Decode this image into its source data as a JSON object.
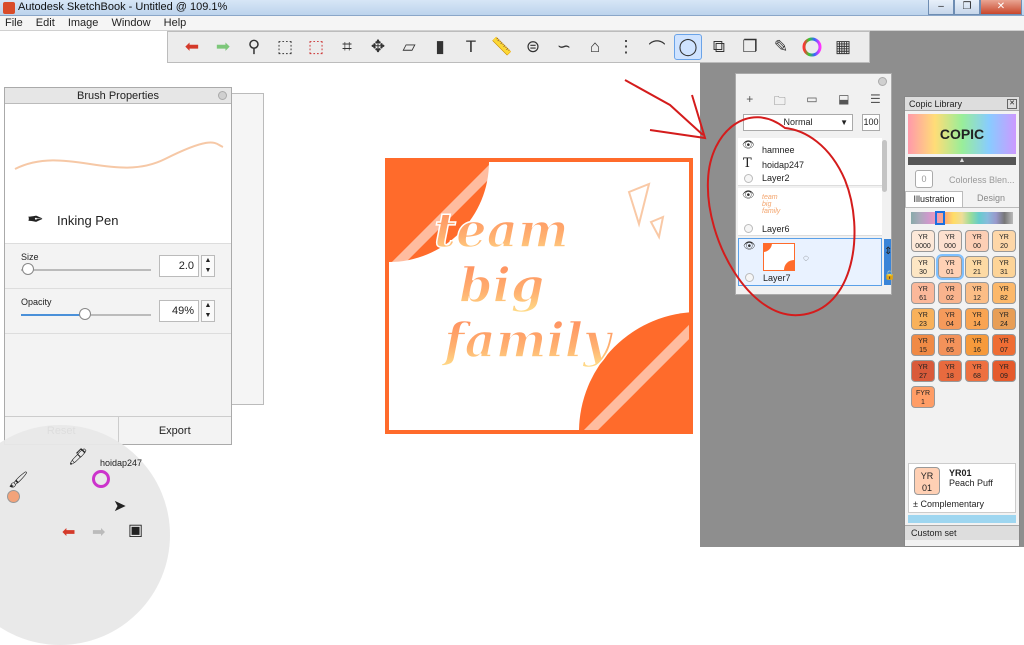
{
  "window": {
    "title": "Autodesk SketchBook - Untitled @ 109.1%",
    "controls": [
      "–",
      "❐",
      "✕"
    ]
  },
  "menu": [
    "File",
    "Edit",
    "Image",
    "Window",
    "Help"
  ],
  "toolbar": {
    "tools": [
      "undo-icon",
      "redo-icon",
      "zoom-icon",
      "select-rect-icon",
      "select-lasso-icon",
      "crop-icon",
      "transform-icon",
      "distort-icon",
      "fill-icon",
      "text-icon",
      "ruler-icon",
      "ellipse-icon",
      "french-curve-icon",
      "perspective-icon",
      "symmetry-icon",
      "stroke-icon",
      "predictive-stroke-icon",
      "shape-icon",
      "copy-icon",
      "brush-library-icon",
      "color-wheel-icon",
      "panels-icon"
    ],
    "active": "predictive-stroke-icon",
    "text_glyph": "T"
  },
  "brush_properties": {
    "title": "Brush Properties",
    "brush_name": "Inking Pen",
    "size_label": "Size",
    "size_value": "2.0",
    "size_fraction": 0.05,
    "opacity_label": "Opacity",
    "opacity_value": "49%",
    "opacity_fraction": 0.49,
    "reset_label": "Reset",
    "export_label": "Export"
  },
  "artwork": {
    "lines": [
      "team",
      "big",
      "family"
    ]
  },
  "layers_panel": {
    "blend_mode": "Normal",
    "opacity": "100",
    "layers": [
      {
        "name": "Layer2",
        "sub": "hamnee",
        "sub2": "hoidap247"
      },
      {
        "name": "Layer6",
        "sub": "",
        "sub2": ""
      },
      {
        "name": "Layer7",
        "sub": "",
        "sub2": ""
      }
    ]
  },
  "copic_library": {
    "title": "Copic Library",
    "logo": "COPIC",
    "colorless_code": "0",
    "colorless_label": "Colorless Blen...",
    "tabs": [
      "Illustration",
      "Design"
    ],
    "chips": [
      {
        "code": "YR\n0000",
        "color": "#fde8d8"
      },
      {
        "code": "YR\n000",
        "color": "#fde0cf"
      },
      {
        "code": "YR\n00",
        "color": "#fdcfb5"
      },
      {
        "code": "YR\n20",
        "color": "#fed7a8"
      },
      {
        "code": "YR\n30",
        "color": "#fde6c4"
      },
      {
        "code": "YR\n01",
        "color": "#ffd0b4"
      },
      {
        "code": "YR\n21",
        "color": "#fddaa4"
      },
      {
        "code": "YR\n31",
        "color": "#fdd498"
      },
      {
        "code": "YR\n61",
        "color": "#fbb89a"
      },
      {
        "code": "YR\n02",
        "color": "#f9b38d"
      },
      {
        "code": "YR\n12",
        "color": "#fbbd86"
      },
      {
        "code": "YR\n82",
        "color": "#fcb86a"
      },
      {
        "code": "YR\n23",
        "color": "#f8b15a"
      },
      {
        "code": "YR\n04",
        "color": "#f69a5b"
      },
      {
        "code": "YR\n14",
        "color": "#f9a452"
      },
      {
        "code": "YR\n24",
        "color": "#e89e56"
      },
      {
        "code": "YR\n15",
        "color": "#f08a45"
      },
      {
        "code": "YR\n65",
        "color": "#f3925a"
      },
      {
        "code": "YR\n16",
        "color": "#f79a3b"
      },
      {
        "code": "YR\n07",
        "color": "#ef6d34"
      },
      {
        "code": "YR\n27",
        "color": "#d95a3a"
      },
      {
        "code": "YR\n18",
        "color": "#e86a3e"
      },
      {
        "code": "YR\n68",
        "color": "#ee7040"
      },
      {
        "code": "YR\n09",
        "color": "#e55a2c"
      },
      {
        "code": "FYR\n1",
        "color": "#ff9d66"
      }
    ],
    "selected_code": "YR01",
    "selected_name": "Peach Puff",
    "complementary_label": "Complementary",
    "custom_set_label": "Custom set"
  },
  "lagoon": {
    "text_layer": "hamnee",
    "text_layer2": "hoidap247"
  },
  "colors": {
    "accent": "#ff6b2b",
    "annotation_red": "#d41c1c",
    "panel_bg": "#8e8e8e"
  }
}
